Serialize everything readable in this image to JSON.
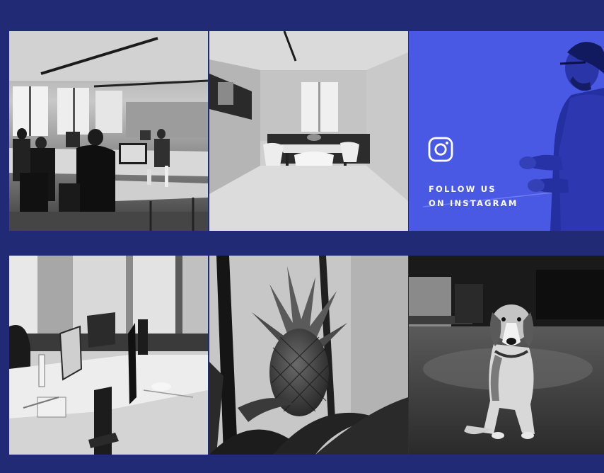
{
  "instagram": {
    "line1": "FOLLOW US",
    "line2": "ON INSTAGRAM",
    "icon": "instagram-icon",
    "tile_color": "#4a59e4"
  },
  "colors": {
    "page_background": "#212a74",
    "text": "#ffffff"
  },
  "photos": [
    {
      "subject": "open-plan office with people working at desks"
    },
    {
      "subject": "meeting room with table and white chairs"
    },
    {
      "subject": "desks with iMac computers by a window"
    },
    {
      "subject": "pineapple plant"
    },
    {
      "subject": "beagle dog sitting on the floor"
    }
  ]
}
